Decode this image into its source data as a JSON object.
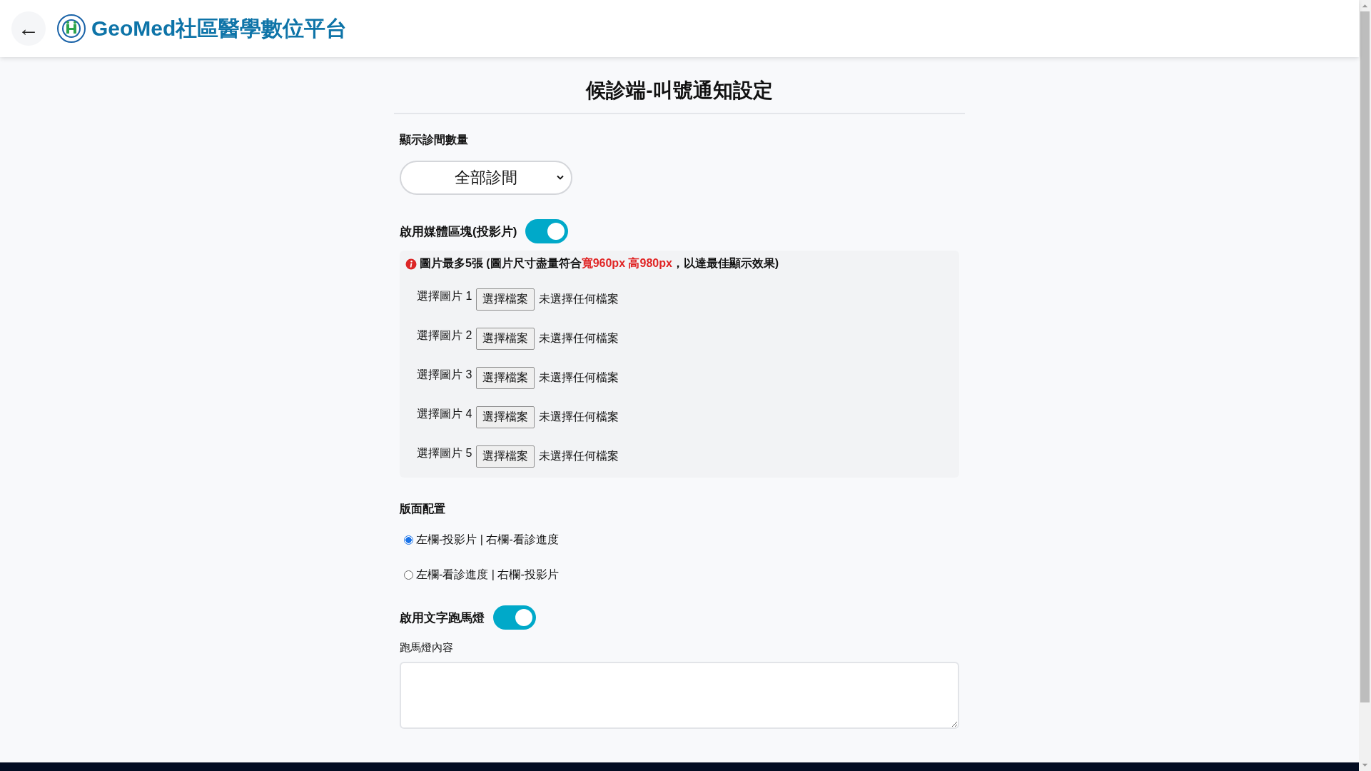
{
  "header": {
    "back_icon": "←",
    "brand": "GeoMed社區醫學數位平台"
  },
  "page_title": "候診端-叫號通知設定",
  "clinic_count": {
    "label": "顯示診間數量",
    "value": "全部診間"
  },
  "media": {
    "label": "啟用媒體區塊(投影片)",
    "on": true,
    "note": [
      {
        "text": "圖片最多5張 (圖片尺寸盡量符合",
        "highlight": false
      },
      {
        "text": "寬960px 高980px",
        "highlight": true
      },
      {
        "text": "，以達最佳顯示效果)",
        "highlight": false
      }
    ],
    "images": [
      {
        "label": "選擇圖片 1",
        "button": "選擇檔案",
        "status": "未選擇任何檔案"
      },
      {
        "label": "選擇圖片 2",
        "button": "選擇檔案",
        "status": "未選擇任何檔案"
      },
      {
        "label": "選擇圖片 3",
        "button": "選擇檔案",
        "status": "未選擇任何檔案"
      },
      {
        "label": "選擇圖片 4",
        "button": "選擇檔案",
        "status": "未選擇任何檔案"
      },
      {
        "label": "選擇圖片 5",
        "button": "選擇檔案",
        "status": "未選擇任何檔案"
      }
    ]
  },
  "layout": {
    "label": "版面配置",
    "options": [
      {
        "label": "左欄-投影片 | 右欄-看診進度",
        "selected": true
      },
      {
        "label": "左欄-看診進度 | 右欄-投影片",
        "selected": false
      }
    ]
  },
  "marquee": {
    "label": "啟用文字跑馬燈",
    "on": true,
    "content_label": "跑馬燈內容"
  }
}
